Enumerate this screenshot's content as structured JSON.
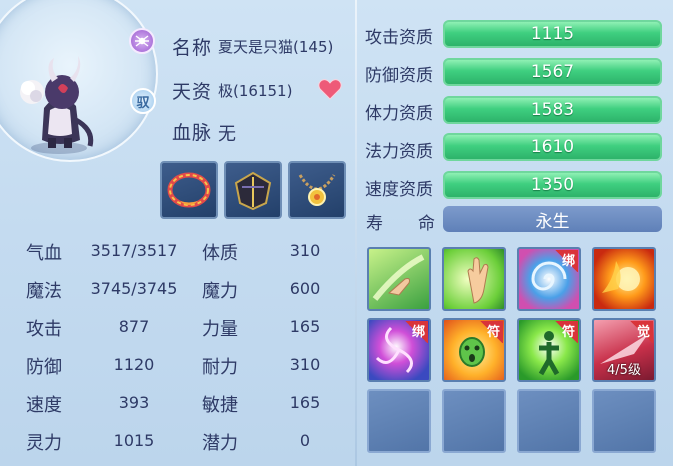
{
  "pet": {
    "name_label": "名称",
    "name_value": "夏天是只猫(145)",
    "talent_label": "天资",
    "talent_value": "极(16151)",
    "blood_label": "血脉",
    "blood_value": "无",
    "ride_badge": "驭"
  },
  "stats": [
    {
      "label": "气血",
      "value": "3517/3517",
      "label2": "体质",
      "value2": "310"
    },
    {
      "label": "魔法",
      "value": "3745/3745",
      "label2": "魔力",
      "value2": "600"
    },
    {
      "label": "攻击",
      "value": "877",
      "label2": "力量",
      "value2": "165"
    },
    {
      "label": "防御",
      "value": "1120",
      "label2": "耐力",
      "value2": "310"
    },
    {
      "label": "速度",
      "value": "393",
      "label2": "敏捷",
      "value2": "165"
    },
    {
      "label": "灵力",
      "value": "1015",
      "label2": "潜力",
      "value2": "0"
    }
  ],
  "aptitudes": [
    {
      "label": "攻击资质",
      "value": "1115"
    },
    {
      "label": "防御资质",
      "value": "1567"
    },
    {
      "label": "体力资质",
      "value": "1583"
    },
    {
      "label": "法力资质",
      "value": "1610"
    },
    {
      "label": "速度资质",
      "value": "1350"
    }
  ],
  "life": {
    "label_a": "寿",
    "label_b": "命",
    "value": "永生"
  },
  "skills": [
    {
      "icon": "hand-swipe-skill-icon",
      "tag": "",
      "level": ""
    },
    {
      "icon": "palm-light-skill-icon",
      "tag": "",
      "level": ""
    },
    {
      "icon": "spiral-wave-skill-icon",
      "tag": "绑",
      "level": ""
    },
    {
      "icon": "fireball-skill-icon",
      "tag": "",
      "level": ""
    },
    {
      "icon": "vortex-skill-icon",
      "tag": "绑",
      "level": ""
    },
    {
      "icon": "ghost-face-skill-icon",
      "tag": "符",
      "level": ""
    },
    {
      "icon": "figure-light-skill-icon",
      "tag": "符",
      "level": ""
    },
    {
      "icon": "awaken-skill-icon",
      "tag": "觉",
      "level": "4/5级"
    }
  ],
  "colors": {
    "text": "#2e3a66",
    "aptitude_bar": "#3fcf80",
    "life_bar": "#6f8fc4"
  }
}
